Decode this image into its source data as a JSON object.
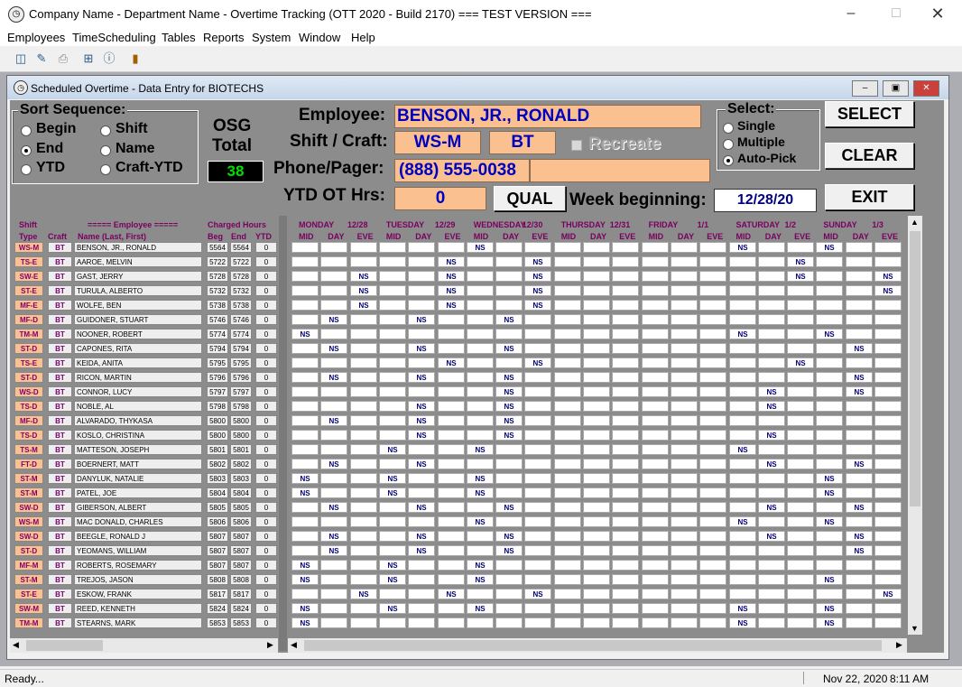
{
  "window": {
    "title": "Company Name - Department Name - Overtime Tracking (OTT 2020 - Build 2170) === TEST VERSION ==="
  },
  "menu": [
    "Employees",
    "TimeScheduling",
    "Tables",
    "Reports",
    "System",
    "Window",
    "Help"
  ],
  "child": {
    "title": "Scheduled Overtime - Data Entry for BIOTECHS"
  },
  "sort": {
    "legend": "Sort Sequence:",
    "options": [
      "Begin",
      "End",
      "YTD",
      "Shift",
      "Name",
      "Craft-YTD"
    ],
    "selected": "End"
  },
  "osg": {
    "line1": "OSG",
    "line2": "Total",
    "value": "38"
  },
  "employee": {
    "label_employee": "Employee:",
    "name": "BENSON, JR., RONALD",
    "label_shift": "Shift / Craft:",
    "shift": "WS-M",
    "craft": "BT",
    "recreate": "Recreate",
    "label_phone": "Phone/Pager:",
    "phone": "(888) 555-0038",
    "pager": "",
    "label_ytd": "YTD OT Hrs:",
    "ytd": "0"
  },
  "select": {
    "legend": "Select:",
    "options": [
      "Single",
      "Multiple",
      "Auto-Pick"
    ],
    "selected": "Auto-Pick"
  },
  "buttons": {
    "select": "SELECT",
    "clear": "CLEAR",
    "exit": "EXIT",
    "qual": "QUAL"
  },
  "week": {
    "label": "Week beginning:",
    "value": "12/28/20"
  },
  "grid_headers": {
    "shift": "Shift",
    "type": "Type",
    "craft": "Craft",
    "employee": "===== Employee =====",
    "name": "Name (Last, First)",
    "charged": "Charged Hours",
    "beg": "Beg",
    "end": "End",
    "ytd": "YTD",
    "days": [
      {
        "name": "MONDAY",
        "date": "12/28"
      },
      {
        "name": "TUESDAY",
        "date": "12/29"
      },
      {
        "name": "WEDNESDAY",
        "date": "12/30"
      },
      {
        "name": "THURSDAY",
        "date": "12/31"
      },
      {
        "name": "FRIDAY",
        "date": "1/1"
      },
      {
        "name": "SATURDAY",
        "date": "1/2"
      },
      {
        "name": "SUNDAY",
        "date": "1/3"
      }
    ],
    "shifts": [
      "MID",
      "DAY",
      "EVE"
    ]
  },
  "rows": [
    {
      "type": "WS-M",
      "craft": "BT",
      "name": "BENSON, JR., RONALD",
      "beg": "5564",
      "end": "5564",
      "ytd": "0",
      "ns": [
        6,
        15,
        18
      ]
    },
    {
      "type": "TS-E",
      "craft": "BT",
      "name": "AAROE, MELVIN",
      "beg": "5722",
      "end": "5722",
      "ytd": "0",
      "ns": [
        5,
        8,
        17
      ]
    },
    {
      "type": "SW-E",
      "craft": "BT",
      "name": "GAST, JERRY",
      "beg": "5728",
      "end": "5728",
      "ytd": "0",
      "ns": [
        2,
        5,
        8,
        17,
        20
      ]
    },
    {
      "type": "ST-E",
      "craft": "BT",
      "name": "TURULA, ALBERTO",
      "beg": "5732",
      "end": "5732",
      "ytd": "0",
      "ns": [
        2,
        5,
        8,
        20
      ]
    },
    {
      "type": "MF-E",
      "craft": "BT",
      "name": "WOLFE, BEN",
      "beg": "5738",
      "end": "5738",
      "ytd": "0",
      "ns": [
        2,
        5,
        8
      ]
    },
    {
      "type": "MF-D",
      "craft": "BT",
      "name": "GUIDONER, STUART",
      "beg": "5746",
      "end": "5746",
      "ytd": "0",
      "ns": [
        1,
        4,
        7
      ]
    },
    {
      "type": "TM-M",
      "craft": "BT",
      "name": "NOONER, ROBERT",
      "beg": "5774",
      "end": "5774",
      "ytd": "0",
      "ns": [
        0,
        15,
        18
      ]
    },
    {
      "type": "ST-D",
      "craft": "BT",
      "name": "CAPONES, RITA",
      "beg": "5794",
      "end": "5794",
      "ytd": "0",
      "ns": [
        1,
        4,
        7,
        19
      ]
    },
    {
      "type": "TS-E",
      "craft": "BT",
      "name": "KEIDA, ANITA",
      "beg": "5795",
      "end": "5795",
      "ytd": "0",
      "ns": [
        5,
        8,
        17
      ]
    },
    {
      "type": "ST-D",
      "craft": "BT",
      "name": "RICON, MARTIN",
      "beg": "5796",
      "end": "5796",
      "ytd": "0",
      "ns": [
        1,
        4,
        7,
        19
      ]
    },
    {
      "type": "WS-D",
      "craft": "BT",
      "name": "CONNOR, LUCY",
      "beg": "5797",
      "end": "5797",
      "ytd": "0",
      "ns": [
        7,
        16,
        19
      ]
    },
    {
      "type": "TS-D",
      "craft": "BT",
      "name": "NOBLE, AL",
      "beg": "5798",
      "end": "5798",
      "ytd": "0",
      "ns": [
        4,
        7,
        16
      ]
    },
    {
      "type": "MF-D",
      "craft": "BT",
      "name": "ALVARADO, THYKASA",
      "beg": "5800",
      "end": "5800",
      "ytd": "0",
      "ns": [
        1,
        4,
        7
      ]
    },
    {
      "type": "TS-D",
      "craft": "BT",
      "name": "KOSLO, CHRISTINA",
      "beg": "5800",
      "end": "5800",
      "ytd": "0",
      "ns": [
        4,
        7,
        16
      ]
    },
    {
      "type": "TS-M",
      "craft": "BT",
      "name": "MATTESON, JOSEPH",
      "beg": "5801",
      "end": "5801",
      "ytd": "0",
      "ns": [
        3,
        6,
        15
      ]
    },
    {
      "type": "FT-D",
      "craft": "BT",
      "name": "BOERNERT, MATT",
      "beg": "5802",
      "end": "5802",
      "ytd": "0",
      "ns": [
        1,
        4,
        16,
        19
      ]
    },
    {
      "type": "ST-M",
      "craft": "BT",
      "name": "DANYLUK, NATALIE",
      "beg": "5803",
      "end": "5803",
      "ytd": "0",
      "ns": [
        0,
        3,
        6,
        18
      ]
    },
    {
      "type": "ST-M",
      "craft": "BT",
      "name": "PATEL, JOE",
      "beg": "5804",
      "end": "5804",
      "ytd": "0",
      "ns": [
        0,
        3,
        6,
        18
      ]
    },
    {
      "type": "SW-D",
      "craft": "BT",
      "name": "GIBERSON, ALBERT",
      "beg": "5805",
      "end": "5805",
      "ytd": "0",
      "ns": [
        1,
        4,
        7,
        16,
        19
      ]
    },
    {
      "type": "WS-M",
      "craft": "BT",
      "name": "MAC DONALD, CHARLES",
      "beg": "5806",
      "end": "5806",
      "ytd": "0",
      "ns": [
        6,
        15,
        18
      ]
    },
    {
      "type": "SW-D",
      "craft": "BT",
      "name": "BEEGLE, RONALD J",
      "beg": "5807",
      "end": "5807",
      "ytd": "0",
      "ns": [
        1,
        4,
        7,
        16,
        19
      ]
    },
    {
      "type": "ST-D",
      "craft": "BT",
      "name": "YEOMANS, WILLIAM",
      "beg": "5807",
      "end": "5807",
      "ytd": "0",
      "ns": [
        1,
        4,
        7,
        19
      ]
    },
    {
      "type": "MF-M",
      "craft": "BT",
      "name": "ROBERTS, ROSEMARY",
      "beg": "5807",
      "end": "5807",
      "ytd": "0",
      "ns": [
        0,
        3,
        6
      ]
    },
    {
      "type": "ST-M",
      "craft": "BT",
      "name": "TREJOS, JASON",
      "beg": "5808",
      "end": "5808",
      "ytd": "0",
      "ns": [
        0,
        3,
        6,
        18
      ]
    },
    {
      "type": "ST-E",
      "craft": "BT",
      "name": "ESKOW, FRANK",
      "beg": "5817",
      "end": "5817",
      "ytd": "0",
      "ns": [
        2,
        5,
        8,
        20
      ]
    },
    {
      "type": "SW-M",
      "craft": "BT",
      "name": "REED, KENNETH",
      "beg": "5824",
      "end": "5824",
      "ytd": "0",
      "ns": [
        0,
        3,
        6,
        15,
        18
      ]
    },
    {
      "type": "TM-M",
      "craft": "BT",
      "name": "STEARNS, MARK",
      "beg": "5853",
      "end": "5853",
      "ytd": "0",
      "ns": [
        0,
        15,
        18
      ]
    }
  ],
  "ns_text": "NS",
  "status": {
    "left": "Ready...",
    "date": "Nov 22, 2020",
    "time": "8:11 AM"
  }
}
